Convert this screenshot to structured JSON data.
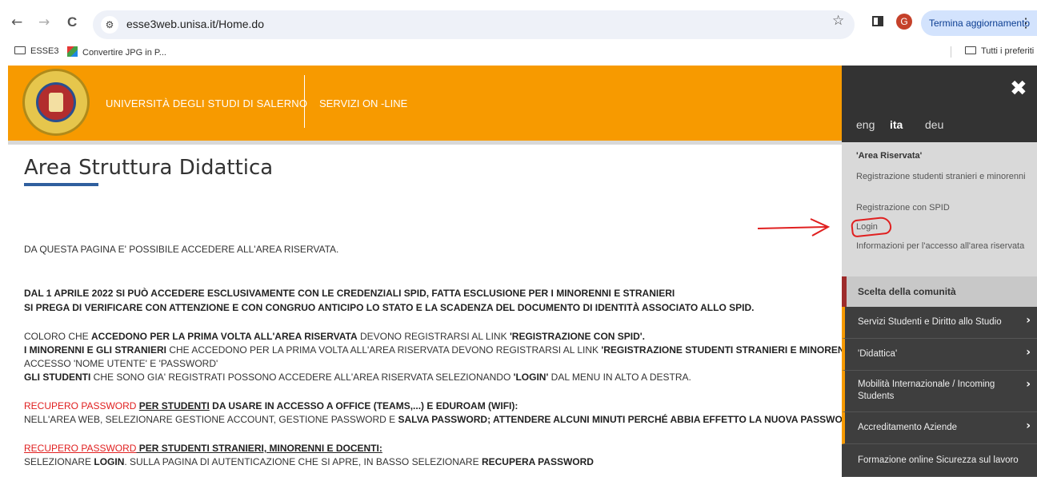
{
  "browser": {
    "back": "←",
    "forward": "→",
    "reload": "C",
    "url": "esse3web.unisa.it/Home.do",
    "star": "☆",
    "avatar_letter": "G",
    "update_label": "Termina aggiornamento",
    "menu_dots": "⋮"
  },
  "bookmarks": {
    "items": [
      "ESSE3",
      "Convertire JPG in P..."
    ],
    "all_label": "Tutti i preferiti"
  },
  "header": {
    "university": "UNIVERSITÀ DEGLI STUDI DI SALERNO",
    "services": "SERVIZI ON -LINE",
    "accent": "#f79a00"
  },
  "main": {
    "title": "Area Struttura Didattica",
    "intro": "DA QUESTA PAGINA E' POSSIBILE ACCEDERE ALL'AREA RISERVATA.",
    "notice1": "DAL 1 APRILE 2022 SI PUÒ ACCEDERE ESCLUSIVAMENTE CON LE CREDENZIALI SPID, FATTA ESCLUSIONE PER I MINORENNI E STRANIERI",
    "notice2": "SI PREGA DI VERIFICARE CON ATTENZIONE E CON CONGRUO ANTICIPO LO STATO E LA SCADENZA DEL DOCUMENTO DI IDENTITÀ ASSOCIATO ALLO SPID.",
    "p1_a": "COLORO CHE ",
    "p1_b": "ACCEDONO PER LA PRIMA VOLTA ALL'AREA RISERVATA",
    "p1_c": " DEVONO REGISTRARSI AL LINK ",
    "p1_d": "'REGISTRAZIONE CON SPID'.",
    "p2_a": "I MINORENNI E GLI STRANIERI",
    "p2_b": " CHE ACCEDONO PER LA PRIMA VOLTA ALL'AREA RISERVATA DEVONO REGISTRARSI AL LINK ",
    "p2_c": "'REGISTRAZIONE STUDENTI STRANIERI E MINORENNI'",
    "p3": "ACCESSO 'NOME UTENTE' E 'PASSWORD'",
    "p4_a": "GLI STUDENTI",
    "p4_b": " CHE SONO GIA' REGISTRATI POSSONO ACCEDERE ALL'AREA RISERVATA SELEZIONANDO ",
    "p4_c": "'LOGIN'",
    "p4_d": " DAL MENU IN ALTO A DESTRA.",
    "r1_a": "RECUPERO PASSWORD ",
    "r1_b": "PER STUDENTI",
    "r1_c": " DA USARE IN ACCESSO A OFFICE (TEAMS,...) E EDUROAM (WIFI):",
    "r2_a": "NELL'AREA WEB, SELEZIONARE GESTIONE ACCOUNT, GESTIONE PASSWORD E ",
    "r2_b": "SALVA PASSWORD; ATTENDERE ALCUNI MINUTI PERCHÉ ABBIA EFFETTO LA NUOVA PASSWORD",
    "r3_a": "RECUPERO PASSWORD",
    "r3_b": " PER STUDENTI STRANIERI, MINORENNI E DOCENTI:",
    "r4_a": "SELEZIONARE ",
    "r4_b": "LOGIN",
    "r4_c": ". SULLA PAGINA DI AUTENTICAZIONE CHE SI APRE, IN BASSO SELEZIONARE ",
    "r4_d": "RECUPERA PASSWORD"
  },
  "sidemenu": {
    "close": "✖",
    "languages": [
      "eng",
      "ita",
      "deu"
    ],
    "active_language": "ita",
    "area_title": "'Area Riservata'",
    "area_items": [
      "Registrazione studenti stranieri e minorenni",
      "Registrazione con SPID",
      "Login",
      "Informazioni per l'accesso all'area riservata"
    ],
    "community_title": "Scelta della comunità",
    "community_items": [
      {
        "label": "Servizi Studenti e Diritto allo Studio",
        "chevron": "›"
      },
      {
        "label": "'Didattica'",
        "chevron": "›"
      },
      {
        "label": "Mobilità Internazionale / Incoming Students",
        "chevron": "›"
      },
      {
        "label": "Accreditamento Aziende",
        "chevron": "›"
      },
      {
        "label": "Formazione online Sicurezza sul lavoro",
        "chevron": ""
      }
    ]
  }
}
